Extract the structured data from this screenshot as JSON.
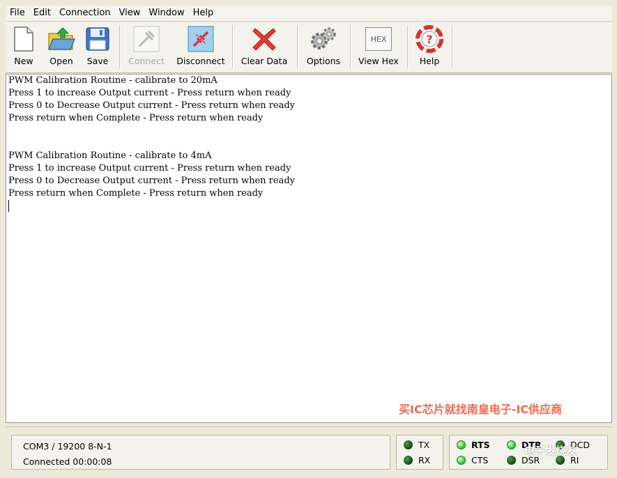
{
  "menu": [
    "File",
    "Edit",
    "Connection",
    "View",
    "Window",
    "Help"
  ],
  "toolbar": {
    "new": "New",
    "open": "Open",
    "save": "Save",
    "connect": "Connect",
    "disconnect": "Disconnect",
    "clear_data": "Clear Data",
    "options": "Options",
    "view_hex": "View Hex",
    "help": "Help",
    "hex_icon_text": "HEX"
  },
  "terminal": {
    "lines": [
      "PWM Calibration Routine - calibrate to 20mA",
      "Press 1 to increase Output current - Press return when ready",
      "Press 0 to Decrease Output current - Press return when ready",
      "Press return when Complete - Press return when ready",
      "",
      "",
      "PWM Calibration Routine - calibrate to 4mA",
      "Press 1 to increase Output current - Press return when ready",
      "Press 0 to Decrease Output current - Press return when ready",
      "Press return when Complete - Press return when ready"
    ]
  },
  "watermark": "买IC芯片就找南皇电子-IC供应商",
  "watermark2": "电子发烧友",
  "status": {
    "port": "COM3 / 19200 8-N-1",
    "connected": "Connected 00:00:08"
  },
  "lamps": {
    "tx": "TX",
    "rx": "RX",
    "rts": "RTS",
    "cts": "CTS",
    "dtr": "DTR",
    "dsr": "DSR",
    "dcd": "DCD",
    "ri": "RI"
  },
  "colors": {
    "led_dark": "#0a4a0a",
    "led_bright": "#2fbf2f",
    "watermark": "#ef6a4e"
  }
}
